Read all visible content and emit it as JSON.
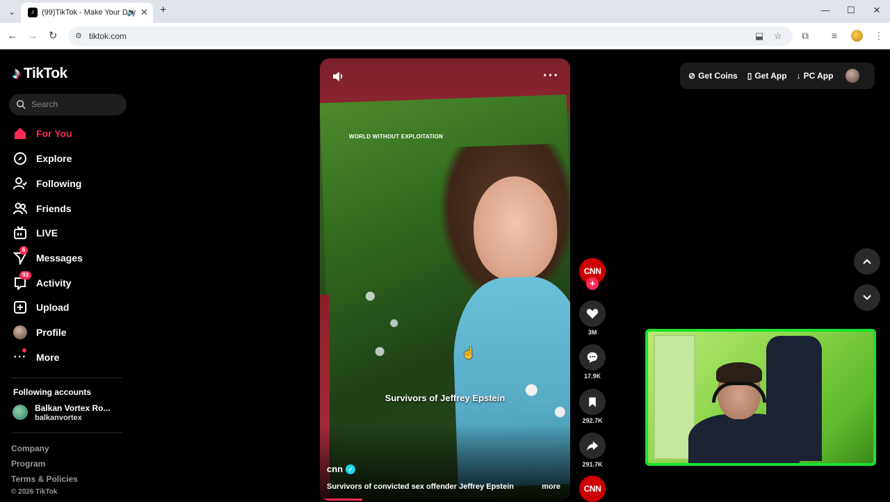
{
  "browser": {
    "tab_title": "(99)TikTok - Make Your Day",
    "url": "tiktok.com"
  },
  "sidebar": {
    "logo": "TikTok",
    "search_placeholder": "Search",
    "nav": [
      {
        "label": "For You",
        "icon": "home-icon",
        "active": true
      },
      {
        "label": "Explore",
        "icon": "compass-icon"
      },
      {
        "label": "Following",
        "icon": "person-follow-icon"
      },
      {
        "label": "Friends",
        "icon": "friends-icon"
      },
      {
        "label": "LIVE",
        "icon": "live-tv-icon"
      },
      {
        "label": "Messages",
        "icon": "send-icon",
        "badge": "6"
      },
      {
        "label": "Activity",
        "icon": "activity-icon",
        "badge": "93"
      },
      {
        "label": "Upload",
        "icon": "plus-square-icon"
      },
      {
        "label": "Profile",
        "icon": "profile-avatar"
      },
      {
        "label": "More",
        "icon": "ellipsis-icon"
      }
    ],
    "following_title": "Following accounts",
    "following_accounts": [
      {
        "name": "Balkan Vortex Ro...",
        "handle": "balkanvortex"
      }
    ],
    "footer": [
      "Company",
      "Program",
      "Terms & Policies"
    ],
    "copyright": "© 2026 TikTok"
  },
  "video": {
    "watermark": "WORLD WITHOUT EXPLOITATION",
    "caption": "Survivors of Jeffrey Epstein",
    "author": "cnn",
    "description": "Survivors of convicted sex offender Jeffrey Epstein",
    "more": "more",
    "progress_fraction": 0.17
  },
  "actions": {
    "avatar_label": "CNN",
    "likes": "3M",
    "comments": "17.9K",
    "saves": "292.7K",
    "shares": "291.7K",
    "sound_label": "CNN"
  },
  "topright": {
    "coins": "Get Coins",
    "app": "Get App",
    "pc": "PC App"
  },
  "colors": {
    "accent": "#fe2c55",
    "verified": "#20d5ec",
    "webcam_border": "#18e22c",
    "cnn": "#cc0000"
  }
}
